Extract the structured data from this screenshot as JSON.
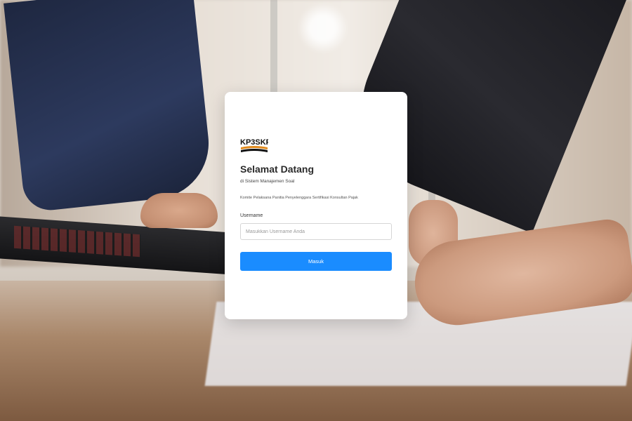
{
  "login": {
    "logo_text": "KP3SKP",
    "title": "Selamat Datang",
    "subtitle": "di Sistem Manajemen Soal",
    "committee": "Komite Pelaksana Panitia Penyelenggara Sertifikasi Konsultan Pajak",
    "username_label": "Username",
    "username_placeholder": "Masukkan Username Anda",
    "username_value": "",
    "submit_label": "Masuk"
  },
  "colors": {
    "primary_button": "#1a8cff",
    "card_background": "#ffffff",
    "logo_accent": "#e08a1e"
  }
}
